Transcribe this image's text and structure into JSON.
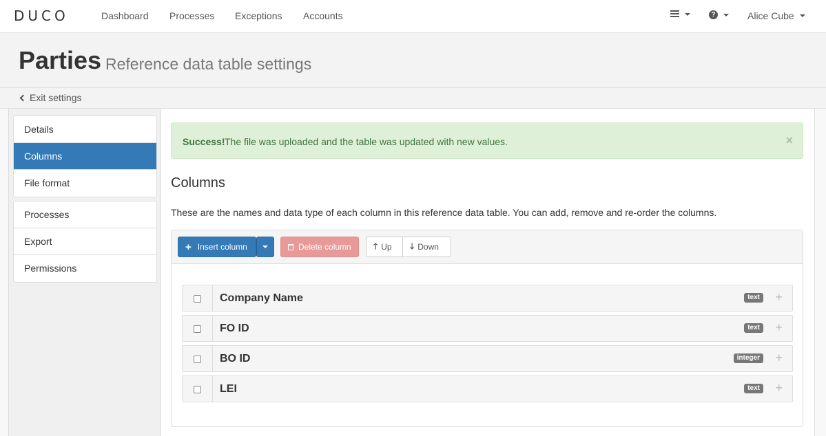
{
  "nav": {
    "logo": "DUCO",
    "links": [
      "Dashboard",
      "Processes",
      "Exceptions",
      "Accounts"
    ],
    "user": "Alice Cube",
    "menu_icon": "hamburger-icon",
    "help_icon": "question-circle-icon"
  },
  "header": {
    "title": "Parties",
    "subtitle": "Reference data table settings",
    "exit_label": "Exit settings"
  },
  "sidebar": {
    "group1": [
      {
        "label": "Details",
        "active": false
      },
      {
        "label": "Columns",
        "active": true
      },
      {
        "label": "File format",
        "active": false
      }
    ],
    "group2": [
      {
        "label": "Processes",
        "active": false
      },
      {
        "label": "Export",
        "active": false
      },
      {
        "label": "Permissions",
        "active": false
      }
    ]
  },
  "alert": {
    "strong": "Success!",
    "text": "The file was uploaded and the table was updated with new values.",
    "close": "×"
  },
  "main": {
    "title": "Columns",
    "description": "These are the names and data type of each column in this reference data table. You can add, remove and re-order the columns."
  },
  "toolbar": {
    "insert_label": "Insert column",
    "delete_label": "Delete column",
    "up_label": "Up",
    "down_label": "Down"
  },
  "columns": [
    {
      "name": "Company Name",
      "type": "text"
    },
    {
      "name": "FO ID",
      "type": "text"
    },
    {
      "name": "BO ID",
      "type": "integer"
    },
    {
      "name": "LEI",
      "type": "text"
    }
  ],
  "colors": {
    "primary": "#337ab7",
    "success_bg": "#dff0d8",
    "success_text": "#3c763d",
    "danger": "#e89a98",
    "badge": "#777777"
  }
}
